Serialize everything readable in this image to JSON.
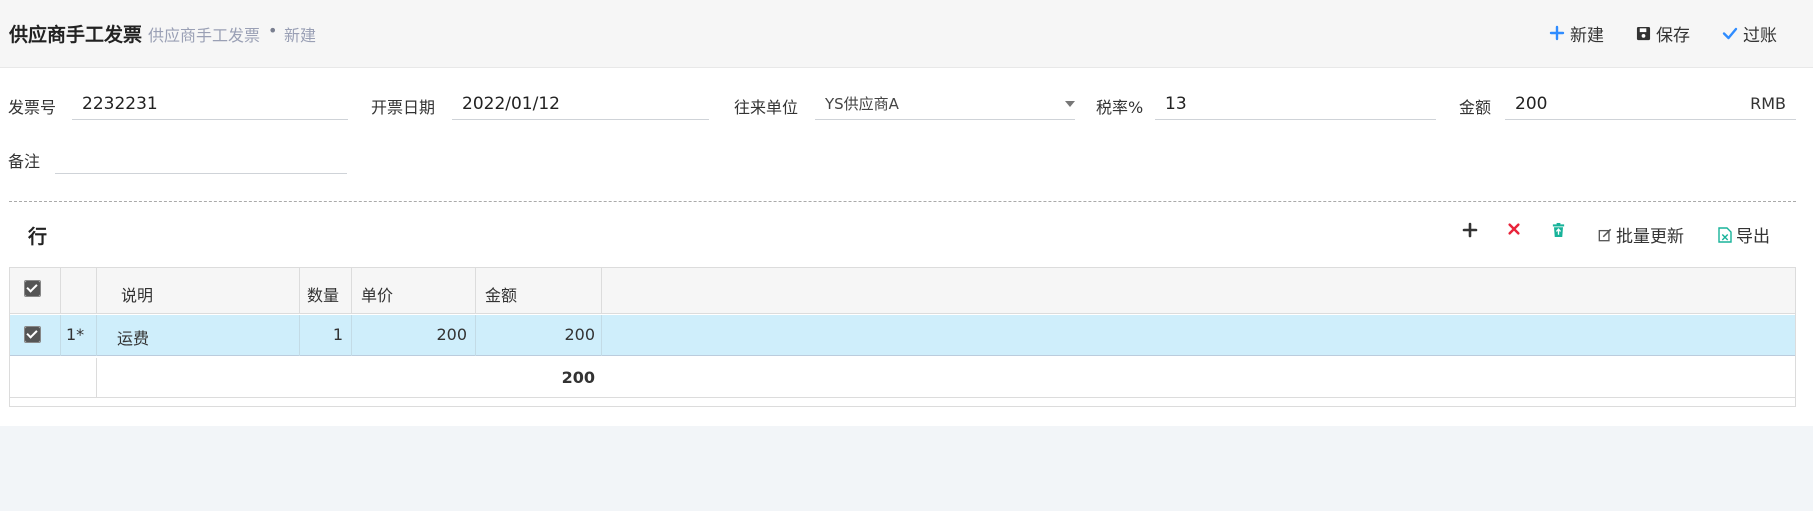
{
  "header": {
    "title": "供应商手工发票",
    "breadcrumb": "供应商手工发票",
    "breadcrumb_sep": "•",
    "breadcrumb_current": "新建",
    "new_label": "新建",
    "save_label": "保存",
    "post_label": "过账"
  },
  "form": {
    "invoice_no_label": "发票号",
    "invoice_no_value": "2232231",
    "invoice_date_label": "开票日期",
    "invoice_date_value": "2022/01/12",
    "partner_label": "往来单位",
    "partner_value": "YS供应商A",
    "tax_rate_label": "税率%",
    "tax_rate_value": "13",
    "amount_label": "金额",
    "amount_value": "200",
    "amount_currency": "RMB",
    "remark_label": "备注",
    "remark_value": ""
  },
  "lines": {
    "title": "行",
    "batch_update_label": "批量更新",
    "export_label": "导出",
    "columns": [
      "说明",
      "数量",
      "单价",
      "金额"
    ],
    "rows": [
      {
        "index": "1*",
        "desc": "运费",
        "qty": "1",
        "price": "200",
        "amount": "200",
        "checked": true
      }
    ],
    "total_amount": "200"
  },
  "colors": {
    "accent_blue": "#2f8cff",
    "delete_red": "#e8233a",
    "trash_teal": "#18b39a",
    "selected_row": "#cfeefb"
  }
}
